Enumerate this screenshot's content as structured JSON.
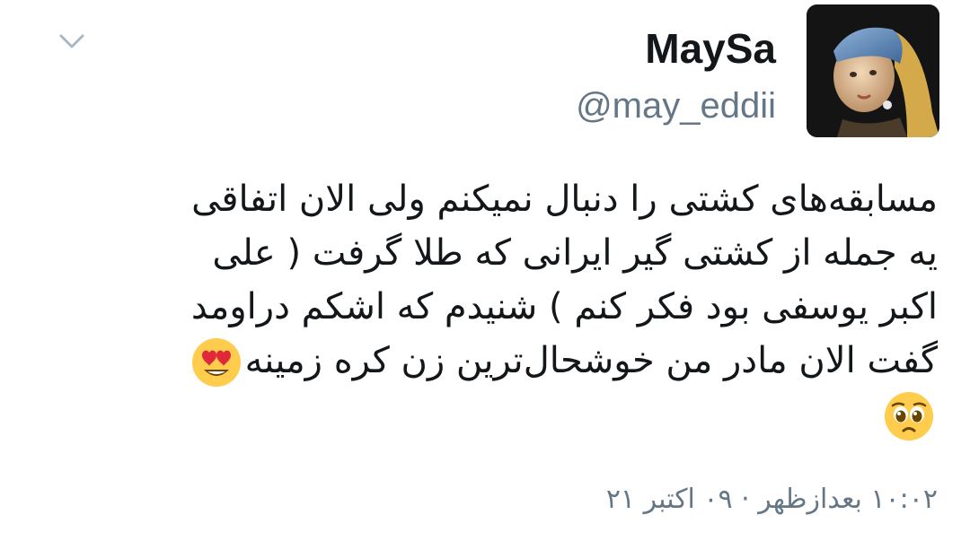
{
  "header": {
    "menu_icon": "chevron-down-icon",
    "avatar_icon": "profile-portrait-avatar",
    "display_name": "MaySa",
    "handle": "@may_eddii"
  },
  "tweet": {
    "lines": [
      "مسابقه‌های کشتی را دنبال نمیکنم ولی الان اتفاقی",
      "یه جمله از کشتی گیر ایرانی که طلا گرفت ( علی",
      "اکبر یوسفی بود فکر کنم ) شنیدم که اشکم دراومد",
      "گفت الان مادر من خوشحال‌ترین زن کره زمینه"
    ],
    "emojis": [
      "heart-eyes-emoji",
      "pleading-face-emoji"
    ]
  },
  "timestamp": "۱۰:۰۲ بعدازظهر · ۰۹ اکتبر ۲۱",
  "colors": {
    "text": "#14171a",
    "secondary": "#657786",
    "chevron": "#aab8c2"
  }
}
